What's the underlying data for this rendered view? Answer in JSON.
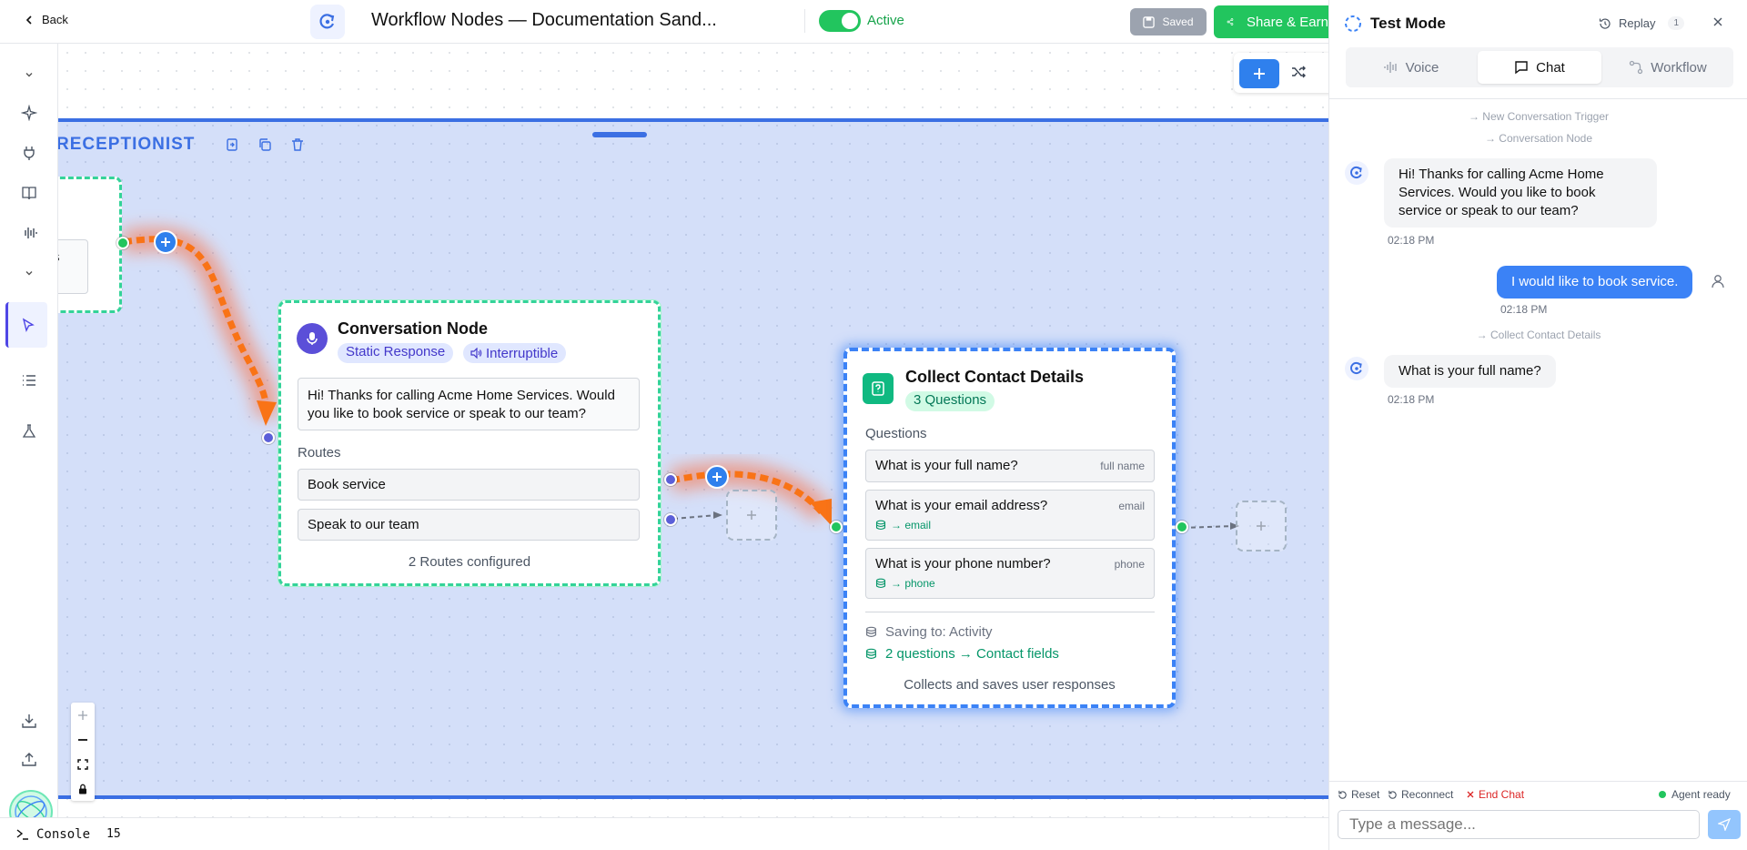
{
  "topbar": {
    "back_label": "Back",
    "workflow_title": "Workflow Nodes — Documentation Sand...",
    "status_label": "Active",
    "saved_label": "Saved",
    "share_label": "Share & Earn"
  },
  "canvas": {
    "group_title": "RECEPTIONIST",
    "prev_node_text": "sms",
    "conversation_node": {
      "title": "Conversation Node",
      "tag_response": "Static Response",
      "tag_interruptible": "Interruptible",
      "message": "Hi! Thanks for calling Acme Home Services. Would you like to book service or speak to our team?",
      "routes_label": "Routes",
      "routes": [
        "Book service",
        "Speak to our team"
      ],
      "footer": "2 Routes configured"
    },
    "collect_node": {
      "title": "Collect Contact Details",
      "badge": "3 Questions",
      "questions_label": "Questions",
      "questions": [
        {
          "text": "What is your full name?",
          "key": "full name",
          "mapping": ""
        },
        {
          "text": "What is your email address?",
          "key": "email",
          "mapping": "→ email"
        },
        {
          "text": "What is your phone number?",
          "key": "phone",
          "mapping": "→ phone"
        }
      ],
      "saving_to": "Saving to: Activity",
      "mapping_summary": "2 questions → Contact fields",
      "footer": "Collects and saves user responses"
    }
  },
  "console": {
    "label": "Console",
    "count": "15"
  },
  "panel": {
    "title": "Test Mode",
    "replay_label": "Replay",
    "replay_count": "1",
    "tabs": [
      "Voice",
      "Chat",
      "Workflow"
    ],
    "active_tab": "Chat",
    "system_1": "→ New Conversation Trigger",
    "system_2": "→ Conversation Node",
    "system_3": "→ Collect Contact Details",
    "messages": [
      {
        "role": "bot",
        "text": "Hi! Thanks for calling Acme Home Services. Would you like to book service or speak to our team?",
        "time": "02:18 PM"
      },
      {
        "role": "user",
        "text": "I would like to book service.",
        "time": "02:18 PM"
      },
      {
        "role": "bot",
        "text": "What is your full name?",
        "time": "02:18 PM"
      }
    ],
    "footer": {
      "reset_label": "Reset",
      "reconnect_label": "Reconnect",
      "end_chat_label": "End Chat",
      "status_label": "Agent ready",
      "input_placeholder": "Type a message..."
    }
  },
  "colors": {
    "accent_blue": "#2f80ed",
    "active_green": "#22c55e",
    "group_blue": "#3b6fe3",
    "edge_orange": "#f97316",
    "end_chat_red": "#dc2626"
  }
}
